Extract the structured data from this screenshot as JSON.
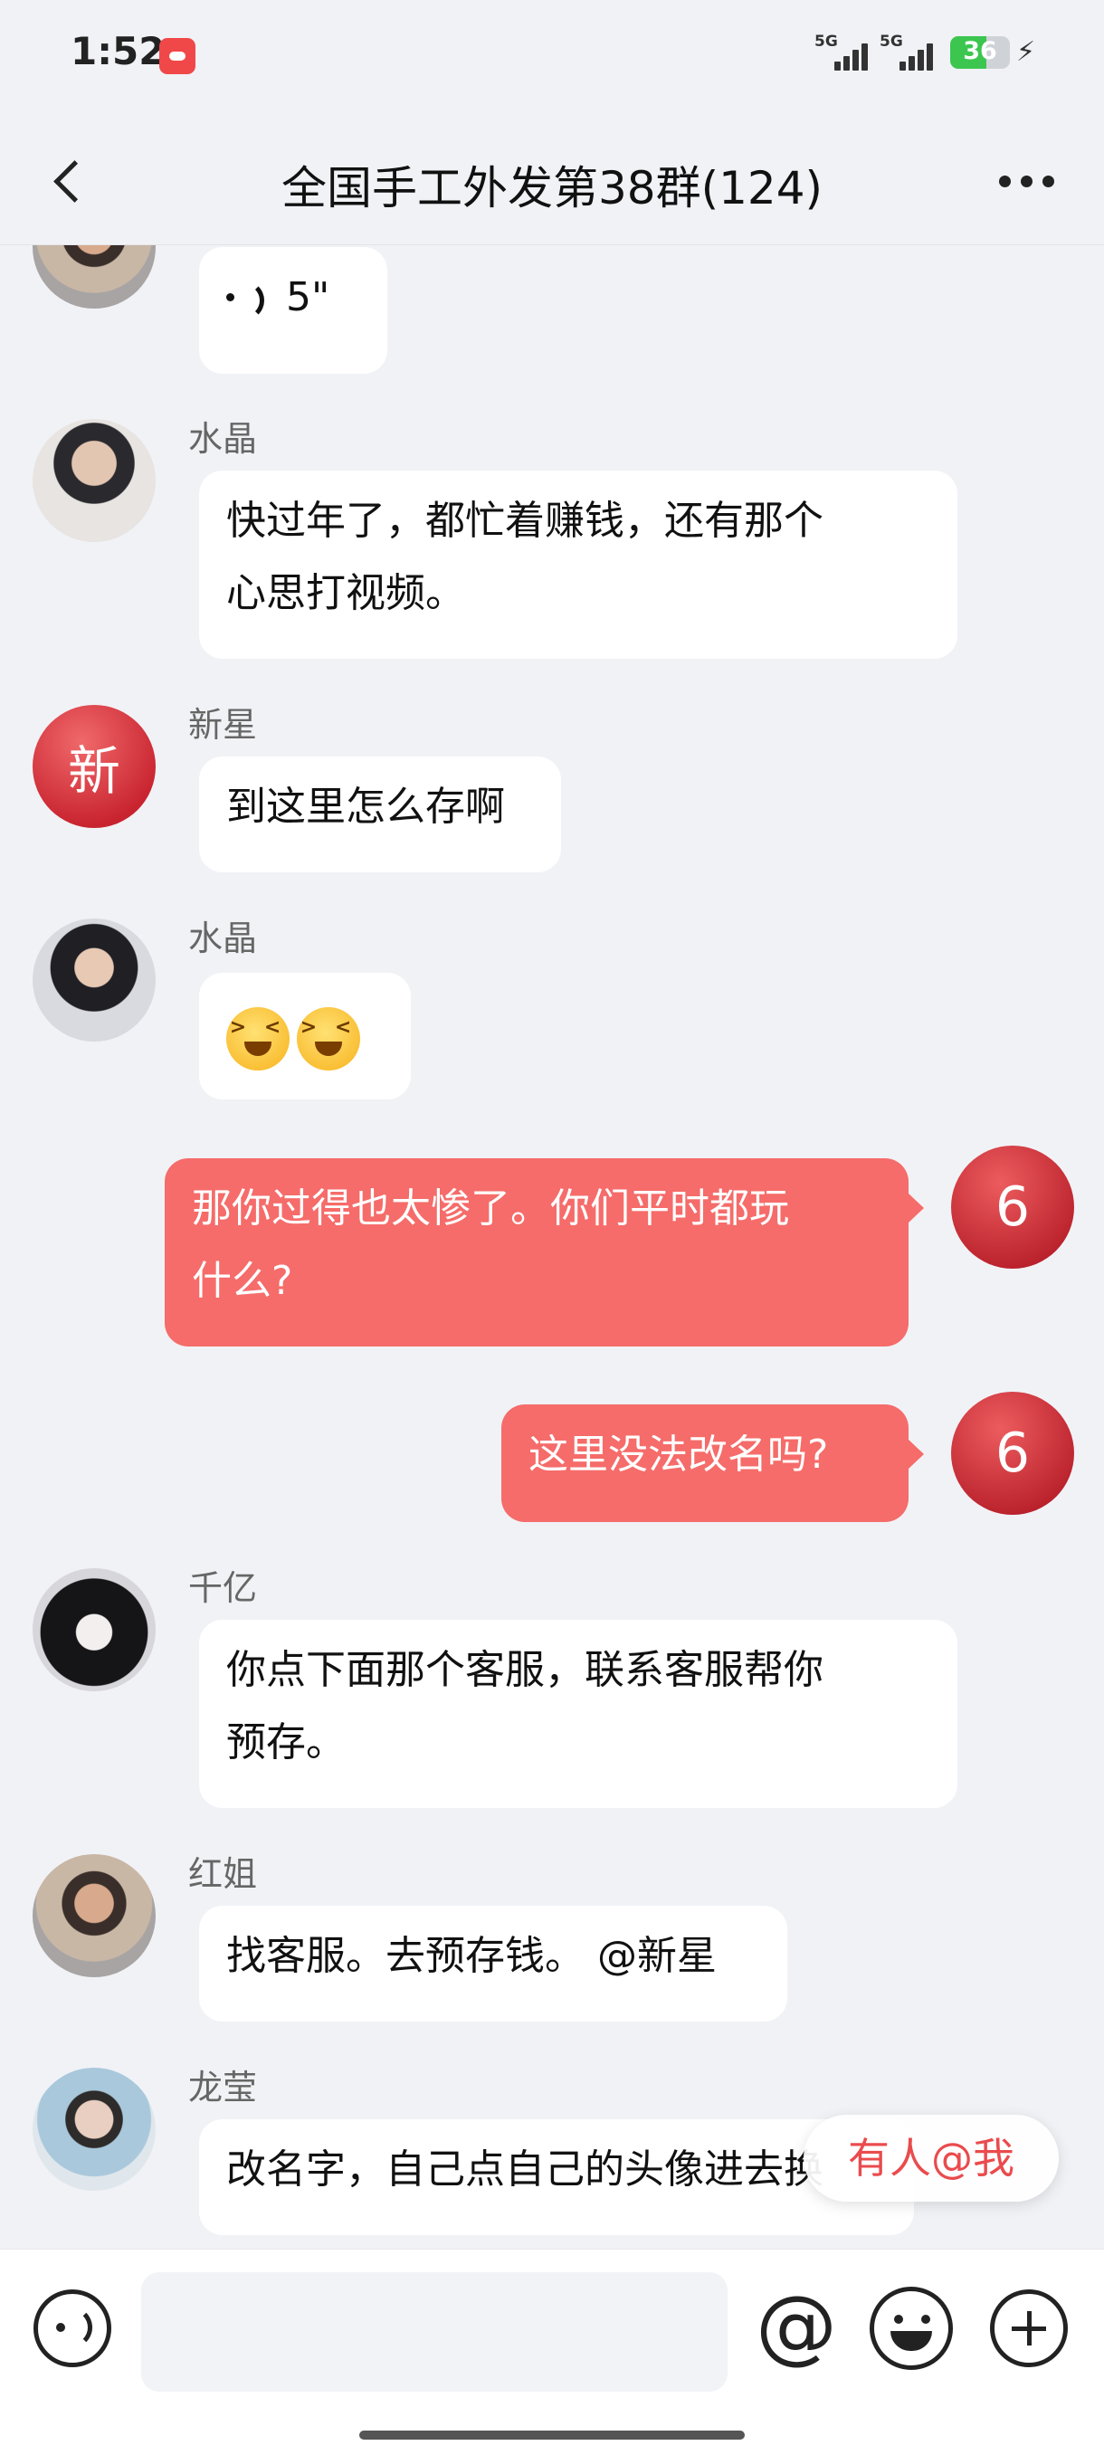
{
  "status_bar": {
    "time": "1:52",
    "network1": "5G",
    "network2": "5G",
    "battery": "36"
  },
  "nav": {
    "title": "全国手工外发第38群(124)"
  },
  "messages": [
    {
      "type": "voice",
      "duration": "5\""
    },
    {
      "sender": "水晶",
      "text_line1": "快过年了，都忙着赚钱，还有那个",
      "text_line2": "心思打视频。"
    },
    {
      "sender": "新星",
      "avatar_char": "新",
      "text": "到这里怎么存啊"
    },
    {
      "sender": "水晶",
      "emoji": [
        "grin-squint-emoji",
        "grin-squint-emoji"
      ]
    },
    {
      "self": true,
      "avatar_char": "6",
      "text_line1": "那你过得也太惨了。你们平时都玩",
      "text_line2": "什么?"
    },
    {
      "self": true,
      "avatar_char": "6",
      "text": "这里没法改名吗?"
    },
    {
      "sender": "千亿",
      "text_line1": "你点下面那个客服，联系客服帮你",
      "text_line2": "预存。"
    },
    {
      "sender": "红姐",
      "text": "找客服。去预存钱。 @新星"
    },
    {
      "sender": "龙莹",
      "text": "改名字，自己点自己的头像进去换"
    }
  ],
  "mention_pill": "有人@我",
  "input_bar": {
    "at_symbol": "@"
  }
}
